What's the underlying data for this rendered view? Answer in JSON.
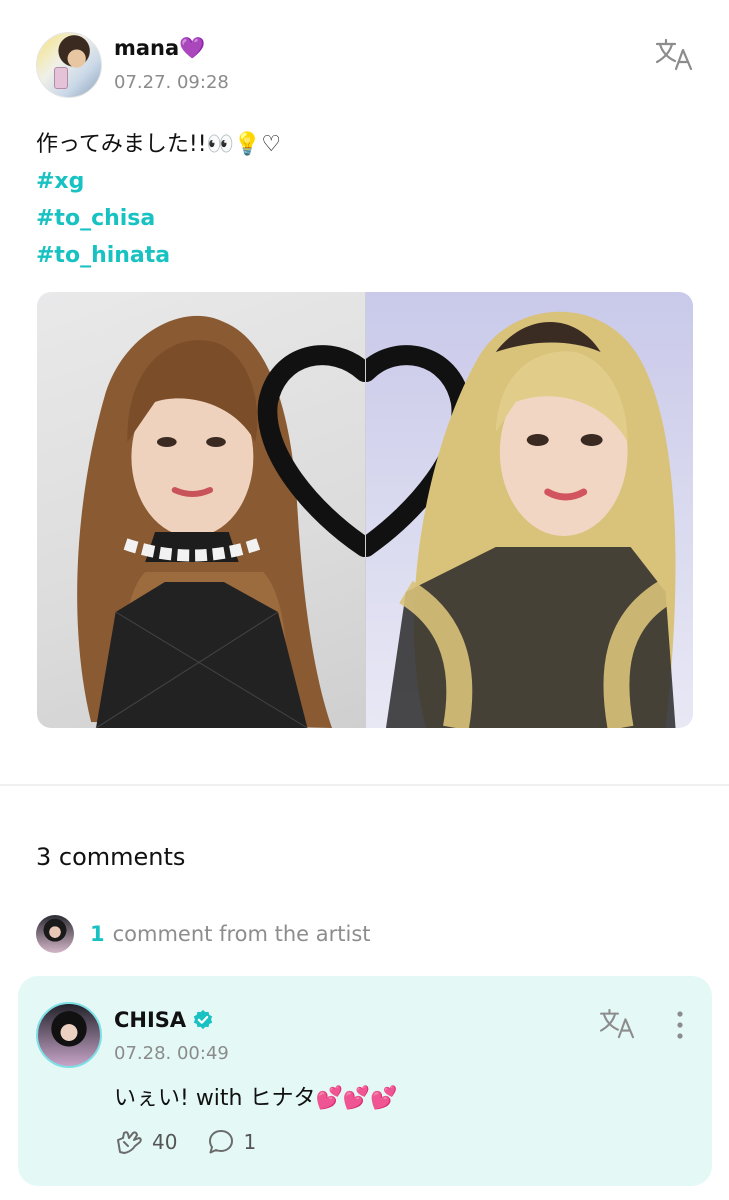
{
  "post": {
    "username": "mana",
    "username_emoji": "💜",
    "timestamp": "07.27. 09:28",
    "text": "作ってみました!!👀💡♡",
    "hashtags": [
      "#xg",
      "#to_chisa",
      "#to_hinata"
    ]
  },
  "comments": {
    "count_label": "3 comments",
    "artist_count": "1",
    "artist_label": "comment from the artist"
  },
  "comment": {
    "author": "CHISA",
    "timestamp": "07.28. 00:49",
    "text": "いぇい!  with ヒナタ💕💕💕",
    "likes": "40",
    "replies": "1"
  },
  "colors": {
    "accent": "#19c2c2",
    "comment_bg": "#e4f9f6",
    "heart_emoji": "#a94cf0"
  }
}
